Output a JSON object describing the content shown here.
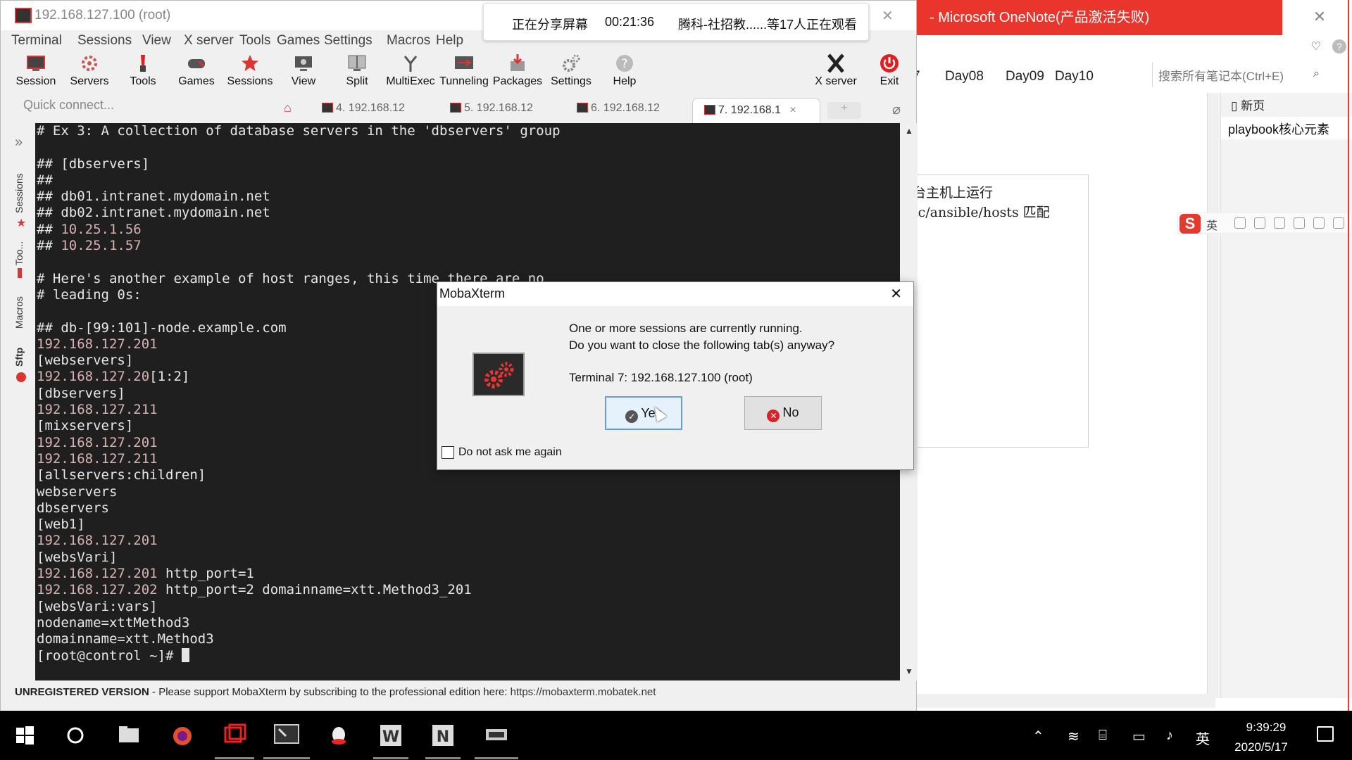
{
  "onenote": {
    "title": "- Microsoft OneNote(产品激活失败)",
    "tab_edge": "7",
    "tabs": [
      "Day08",
      "Day09",
      "Day10"
    ],
    "search_placeholder": "搜索所有笔记本(Ctrl+E)",
    "new_page": "新页",
    "page_item": "playbook核心元素",
    "note_line1": "台主机上运行",
    "note_line2": "tc/ansible/hosts 匹配",
    "ime_lang": "英"
  },
  "moba": {
    "title": "192.168.127.100 (root)",
    "menu": [
      "Terminal",
      "Sessions",
      "View",
      "X server",
      "Tools",
      "Games",
      "Settings",
      "Macros",
      "Help"
    ],
    "toolbar": [
      {
        "label": "Session",
        "icon": "session-icon"
      },
      {
        "label": "Servers",
        "icon": "servers-icon"
      },
      {
        "label": "Tools",
        "icon": "tools-icon"
      },
      {
        "label": "Games",
        "icon": "games-icon"
      },
      {
        "label": "Sessions",
        "icon": "sessions-star-icon"
      },
      {
        "label": "View",
        "icon": "view-icon"
      },
      {
        "label": "Split",
        "icon": "split-icon"
      },
      {
        "label": "MultiExec",
        "icon": "multiexec-icon"
      },
      {
        "label": "Tunneling",
        "icon": "tunneling-icon"
      },
      {
        "label": "Packages",
        "icon": "packages-icon"
      },
      {
        "label": "Settings",
        "icon": "settings-icon"
      },
      {
        "label": "Help",
        "icon": "help-icon"
      },
      {
        "label": "X server",
        "icon": "xserver-icon"
      },
      {
        "label": "Exit",
        "icon": "exit-icon"
      }
    ],
    "quick_connect": "Quick connect...",
    "session_tabs": [
      "4. 192.168.12",
      "5. 192.168.12",
      "6. 192.168.12"
    ],
    "active_tab": "7. 192.168.1",
    "active_tab_close": "×",
    "sidebar": [
      "Sessions",
      "Too...",
      "Macros",
      "Sftp"
    ],
    "terminal_lines": [
      {
        "t": "# Ex 3: A collection of database servers in the 'dbservers' group",
        "c": ""
      },
      {
        "t": "",
        "c": ""
      },
      {
        "t": "## [dbservers]",
        "c": ""
      },
      {
        "t": "##",
        "c": ""
      },
      {
        "t": "## db01.intranet.mydomain.net",
        "c": ""
      },
      {
        "t": "## db02.intranet.mydomain.net",
        "c": ""
      },
      {
        "t": "## ",
        "c": "",
        "ip": "10.25.1.56"
      },
      {
        "t": "## ",
        "c": "",
        "ip": "10.25.1.57"
      },
      {
        "t": "",
        "c": ""
      },
      {
        "t": "# Here's another example of host ranges, this time there are no",
        "c": ""
      },
      {
        "t": "# leading 0s:",
        "c": ""
      },
      {
        "t": "",
        "c": ""
      },
      {
        "t": "## db-[99:101]-node.example.com",
        "c": ""
      },
      {
        "t": "",
        "c": "",
        "ip": "192.168.127.201"
      },
      {
        "t": "[webservers]",
        "c": ""
      },
      {
        "t": "",
        "c": "",
        "ip": "192.168.127.20",
        "rest": "[1:2]"
      },
      {
        "t": "[dbservers]",
        "c": ""
      },
      {
        "t": "",
        "c": "",
        "ip": "192.168.127.211"
      },
      {
        "t": "[mixservers]",
        "c": ""
      },
      {
        "t": "",
        "c": "",
        "ip": "192.168.127.201"
      },
      {
        "t": "",
        "c": "",
        "ip": "192.168.127.211"
      },
      {
        "t": "[allservers:children]",
        "c": ""
      },
      {
        "t": "webservers",
        "c": ""
      },
      {
        "t": "dbservers",
        "c": ""
      },
      {
        "t": "[web1]",
        "c": ""
      },
      {
        "t": "",
        "c": "",
        "ip": "192.168.127.201"
      },
      {
        "t": "[websVari]",
        "c": ""
      },
      {
        "t": "",
        "c": "",
        "ip": "192.168.127.201",
        "rest": " http_port=1"
      },
      {
        "t": "",
        "c": "",
        "ip": "192.168.127.202",
        "rest": " http_port=2 domainname=xtt.Method3_201"
      },
      {
        "t": "[websVari:vars]",
        "c": ""
      },
      {
        "t": "nodename=xttMethod3",
        "c": ""
      },
      {
        "t": "domainname=xtt.Method3",
        "c": ""
      },
      {
        "t": "[root@control ~]# ",
        "c": "",
        "cursor": true
      }
    ],
    "status_bold": "UNREGISTERED VERSION",
    "status_text": " -  Please support MobaXterm by subscribing to the professional edition here:  ",
    "status_link": "https://mobaxterm.mobatek.net"
  },
  "share": {
    "label": "正在分享屏幕",
    "time": "00:21:36",
    "viewers": "腾科-社招教......等17人正在观看"
  },
  "dialog": {
    "title": "MobaXterm",
    "msg1": "One or more sessions are currently running.",
    "msg2": "Do you want to close the following tab(s) anyway?",
    "term": "Terminal 7:  192.168.127.100 (root)",
    "yes": "Yes",
    "no": "No",
    "dont_ask": "Do not ask me again"
  },
  "taskbar": {
    "time": "9:39:29",
    "date": "2020/5/17",
    "ime": "英"
  }
}
